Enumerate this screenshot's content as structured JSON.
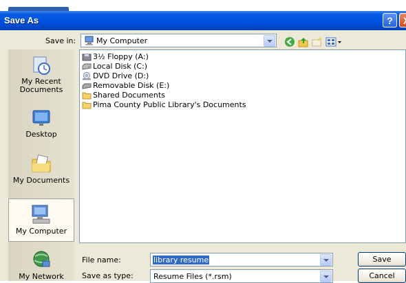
{
  "window": {
    "title": "Save As"
  },
  "titlebar": {
    "help_glyph": "?",
    "close_glyph": "X"
  },
  "savein": {
    "label": "Save in:",
    "value": "My Computer",
    "icon": "computer-icon"
  },
  "toolbar": [
    "back-icon",
    "up-folder-icon",
    "new-folder-icon",
    "views-menu-icon"
  ],
  "places": [
    {
      "label_lines": [
        "My Recent",
        "Documents"
      ],
      "icon": "recent-documents-icon"
    },
    {
      "label_lines": [
        "Desktop"
      ],
      "icon": "desktop-icon"
    },
    {
      "label_lines": [
        "My Documents"
      ],
      "icon": "my-documents-icon"
    },
    {
      "label_lines": [
        "My Computer"
      ],
      "icon": "computer-icon",
      "selected": true
    },
    {
      "label_lines": [
        "My Network"
      ],
      "icon": "network-icon"
    }
  ],
  "files": [
    {
      "name": "3½ Floppy (A:)",
      "icon": "floppy-drive-icon"
    },
    {
      "name": "Local Disk (C:)",
      "icon": "hard-disk-icon"
    },
    {
      "name": "DVD Drive (D:)",
      "icon": "dvd-drive-icon"
    },
    {
      "name": "Removable Disk (E:)",
      "icon": "removable-disk-icon"
    },
    {
      "name": "Shared Documents",
      "icon": "folder-icon"
    },
    {
      "name": "Pima County Public Library's Documents",
      "icon": "folder-icon"
    }
  ],
  "filename": {
    "label": "File name:",
    "value": "library resume"
  },
  "filetype": {
    "label": "Save as type:",
    "value": "Resume Files (*.rsm)"
  },
  "buttons": {
    "save": "Save",
    "cancel": "Cancel"
  },
  "colors": {
    "titlebar": "#0054e3",
    "dialog_bg": "#ece9d8",
    "selection": "#316ac5"
  }
}
